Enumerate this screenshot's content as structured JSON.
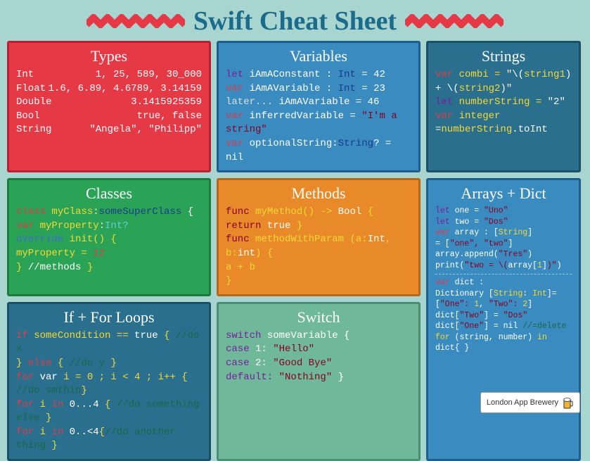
{
  "title": "Swift Cheat Sheet",
  "footer": {
    "label": "London App Brewery"
  },
  "types": {
    "title": "Types",
    "rows": [
      {
        "name": "Int",
        "example": "1, 25, 589, 30_000"
      },
      {
        "name": "Float",
        "example": "1.6, 6.89, 4.6789, 3.14159"
      },
      {
        "name": "Double",
        "example": "3.1415925359"
      },
      {
        "name": "Bool",
        "example": "true, false"
      },
      {
        "name": "String",
        "example": "\"Angela\",  \"Philipp\""
      }
    ]
  },
  "variables": {
    "title": "Variables",
    "lines": [
      {
        "parts": [
          {
            "t": "let ",
            "c": "purple"
          },
          {
            "t": "iAmAConstant : ",
            "c": "white"
          },
          {
            "t": "Int",
            "c": "dblue"
          },
          {
            "t": " = 42",
            "c": "white"
          }
        ]
      },
      {
        "parts": [
          {
            "t": "var ",
            "c": "red"
          },
          {
            "t": "iAmAVariable : ",
            "c": "white"
          },
          {
            "t": "Int",
            "c": "dblue"
          },
          {
            "t": " = 23",
            "c": "white"
          }
        ]
      },
      {
        "parts": [
          {
            "t": "later...  ",
            "c": "gray"
          },
          {
            "t": "iAmAVariable = 46",
            "c": "white"
          }
        ]
      },
      {
        "parts": [
          {
            "t": "var ",
            "c": "red"
          },
          {
            "t": "inferredVariable = ",
            "c": "white"
          },
          {
            "t": "\"I'm a string\"",
            "c": "darkred"
          }
        ]
      },
      {
        "parts": [
          {
            "t": "var ",
            "c": "red"
          },
          {
            "t": "optionalString:",
            "c": "white"
          },
          {
            "t": "String",
            "c": "dblue"
          },
          {
            "t": "? = nil",
            "c": "white"
          }
        ]
      }
    ]
  },
  "strings": {
    "title": "Strings",
    "lines": [
      {
        "parts": [
          {
            "t": "var ",
            "c": "red"
          },
          {
            "t": "combi = ",
            "c": "yellow"
          },
          {
            "t": "\"\\(",
            "c": "white"
          },
          {
            "t": "string1",
            "c": "yellow"
          },
          {
            "t": ")",
            "c": "white"
          }
        ]
      },
      {
        "parts": [
          {
            "t": "+ \\(",
            "c": "white"
          },
          {
            "t": "string2",
            "c": "yellow"
          },
          {
            "t": ")\"",
            "c": "white"
          }
        ]
      },
      {
        "parts": [
          {
            "t": "let ",
            "c": "purple"
          },
          {
            "t": "numberString = ",
            "c": "yellow"
          },
          {
            "t": "\"2\"",
            "c": "white"
          }
        ]
      },
      {
        "parts": [
          {
            "t": "var ",
            "c": "red"
          },
          {
            "t": "integer",
            "c": "yellow"
          }
        ]
      },
      {
        "parts": [
          {
            "t": "=",
            "c": "white"
          },
          {
            "t": "numberString",
            "c": "yellow"
          },
          {
            "t": ".toInt",
            "c": "white"
          }
        ]
      }
    ]
  },
  "classes": {
    "title": "Classes",
    "lines": [
      {
        "parts": [
          {
            "t": "class ",
            "c": "red"
          },
          {
            "t": "myClass",
            "c": "yellow"
          },
          {
            "t": ":",
            "c": "white"
          },
          {
            "t": "someSuperClass",
            "c": "dblue"
          },
          {
            "t": " {",
            "c": "white"
          }
        ]
      },
      {
        "parts": [
          {
            "t": "  var ",
            "c": "red"
          },
          {
            "t": "myProperty",
            "c": "yellow"
          },
          {
            "t": ":",
            "c": "white"
          },
          {
            "t": "Int?",
            "c": "cyan"
          }
        ]
      },
      {
        "parts": [
          {
            "t": "  override ",
            "c": "blue"
          },
          {
            "t": "init() {",
            "c": "yellow"
          }
        ]
      },
      {
        "parts": [
          {
            "t": "    myProperty = ",
            "c": "yellow"
          },
          {
            "t": "12",
            "c": "red"
          }
        ]
      },
      {
        "parts": [
          {
            "t": "  } ",
            "c": "yellow"
          },
          {
            "t": "//methods ",
            "c": "white"
          },
          {
            "t": "}",
            "c": "yellow"
          }
        ]
      }
    ]
  },
  "methods": {
    "title": "Methods",
    "lines": [
      {
        "parts": [
          {
            "t": "func ",
            "c": "darkred"
          },
          {
            "t": "myMethod() -> ",
            "c": "yellow"
          },
          {
            "t": "Bool",
            "c": "white"
          },
          {
            "t": " {",
            "c": "yellow"
          }
        ]
      },
      {
        "parts": [
          {
            "t": "  return ",
            "c": "darkred"
          },
          {
            "t": "true ",
            "c": "white"
          },
          {
            "t": "}",
            "c": "yellow"
          }
        ]
      },
      {
        "parts": [
          {
            "t": "func ",
            "c": "darkred"
          },
          {
            "t": "methodWithParam (a:",
            "c": "yellow"
          },
          {
            "t": "Int",
            "c": "white"
          },
          {
            "t": ", b:",
            "c": "yellow"
          },
          {
            "t": "int",
            "c": "white"
          },
          {
            "t": ") {",
            "c": "yellow"
          }
        ]
      },
      {
        "parts": [
          {
            "t": "   a + b",
            "c": "yellow"
          }
        ]
      },
      {
        "parts": [
          {
            "t": "   }",
            "c": "yellow"
          }
        ]
      }
    ]
  },
  "arrays": {
    "title": "Arrays + Dict",
    "lines": [
      {
        "parts": [
          {
            "t": "let ",
            "c": "purple"
          },
          {
            "t": "one = ",
            "c": "white"
          },
          {
            "t": "\"Uno\"",
            "c": "darkred"
          }
        ]
      },
      {
        "parts": [
          {
            "t": "let ",
            "c": "purple"
          },
          {
            "t": "two = ",
            "c": "white"
          },
          {
            "t": "\"Dos\"",
            "c": "darkred"
          }
        ]
      },
      {
        "parts": [
          {
            "t": "var ",
            "c": "red"
          },
          {
            "t": "array  :  [",
            "c": "white"
          },
          {
            "t": "String",
            "c": "yellow"
          },
          {
            "t": "]",
            "c": "white"
          }
        ]
      },
      {
        "parts": [
          {
            "t": "= [",
            "c": "white"
          },
          {
            "t": "\"one\", \"two\"",
            "c": "darkred"
          },
          {
            "t": "]",
            "c": "white"
          }
        ]
      },
      {
        "parts": [
          {
            "t": "  array.append(",
            "c": "white"
          },
          {
            "t": "\"Tres\"",
            "c": "darkred"
          },
          {
            "t": ")",
            "c": "white"
          }
        ]
      },
      {
        "parts": [
          {
            "t": "print(",
            "c": "white"
          },
          {
            "t": "\"two = \\(",
            "c": "darkred"
          },
          {
            "t": "array[",
            "c": "white"
          },
          {
            "t": "1",
            "c": "yellow"
          },
          {
            "t": "]",
            "c": "white"
          },
          {
            "t": ")\"",
            "c": "darkred"
          },
          {
            "t": ")",
            "c": "white"
          }
        ]
      }
    ],
    "lines2": [
      {
        "parts": [
          {
            "t": "var ",
            "c": "red"
          },
          {
            "t": "dict :",
            "c": "white"
          }
        ]
      },
      {
        "parts": [
          {
            "t": "Dictionary [",
            "c": "white"
          },
          {
            "t": "String",
            "c": "yellow"
          },
          {
            "t": ": ",
            "c": "white"
          },
          {
            "t": "Int",
            "c": "yellow"
          },
          {
            "t": "]=",
            "c": "white"
          }
        ]
      },
      {
        "parts": [
          {
            "t": "[",
            "c": "white"
          },
          {
            "t": "\"One\": ",
            "c": "darkred"
          },
          {
            "t": "1",
            "c": "yellow"
          },
          {
            "t": ", ",
            "c": "white"
          },
          {
            "t": "\"Two\": ",
            "c": "darkred"
          },
          {
            "t": "2",
            "c": "yellow"
          },
          {
            "t": "]",
            "c": "white"
          }
        ]
      },
      {
        "parts": [
          {
            "t": "  dict[",
            "c": "white"
          },
          {
            "t": "\"Two\"",
            "c": "darkred"
          },
          {
            "t": "] = ",
            "c": "white"
          },
          {
            "t": "\"Dos\"",
            "c": "darkred"
          }
        ]
      },
      {
        "parts": [
          {
            "t": "  dict[",
            "c": "white"
          },
          {
            "t": "\"One\"",
            "c": "darkred"
          },
          {
            "t": "] = nil ",
            "c": "white"
          },
          {
            "t": "//=delete",
            "c": "dgreen"
          }
        ]
      },
      {
        "parts": [
          {
            "t": "for ",
            "c": "yellow"
          },
          {
            "t": "(string, number) ",
            "c": "white"
          },
          {
            "t": "in ",
            "c": "yellow"
          },
          {
            "t": "dict{ }",
            "c": "white"
          }
        ]
      }
    ]
  },
  "loops": {
    "title": "If + For Loops",
    "lines": [
      {
        "parts": [
          {
            "t": "if ",
            "c": "red"
          },
          {
            "t": "someCondition == ",
            "c": "yellow"
          },
          {
            "t": "true ",
            "c": "white"
          },
          {
            "t": "{ ",
            "c": "yellow"
          },
          {
            "t": "//do x",
            "c": "dgreen"
          }
        ]
      },
      {
        "parts": [
          {
            "t": "   } ",
            "c": "yellow"
          },
          {
            "t": "else ",
            "c": "red"
          },
          {
            "t": "{ ",
            "c": "yellow"
          },
          {
            "t": "//do y ",
            "c": "dgreen"
          },
          {
            "t": "}",
            "c": "yellow"
          }
        ]
      },
      {
        "parts": [
          {
            "t": "for ",
            "c": "red"
          },
          {
            "t": "var ",
            "c": "white"
          },
          {
            "t": "i = 0 ; i < 4 ; i++ { ",
            "c": "yellow"
          },
          {
            "t": "//do smthin",
            "c": "dgreen"
          },
          {
            "t": "}",
            "c": "yellow"
          }
        ]
      },
      {
        "parts": [
          {
            "t": "for ",
            "c": "red"
          },
          {
            "t": "i ",
            "c": "yellow"
          },
          {
            "t": "in ",
            "c": "red"
          },
          {
            "t": "0...4",
            "c": "white"
          },
          {
            "t": " { ",
            "c": "yellow"
          },
          {
            "t": "//do something else ",
            "c": "dgreen"
          },
          {
            "t": "}",
            "c": "yellow"
          }
        ]
      },
      {
        "parts": [
          {
            "t": "for ",
            "c": "red"
          },
          {
            "t": "i ",
            "c": "yellow"
          },
          {
            "t": "in ",
            "c": "red"
          },
          {
            "t": "0..<4",
            "c": "white"
          },
          {
            "t": "{",
            "c": "yellow"
          },
          {
            "t": "//do another thing ",
            "c": "dgreen"
          },
          {
            "t": "}",
            "c": "yellow"
          }
        ]
      }
    ]
  },
  "switch": {
    "title": "Switch",
    "lines": [
      {
        "parts": [
          {
            "t": "switch ",
            "c": "purple"
          },
          {
            "t": "someVariable {",
            "c": "white"
          }
        ]
      },
      {
        "parts": [
          {
            "t": "  case ",
            "c": "purple"
          },
          {
            "t": "1: ",
            "c": "white"
          },
          {
            "t": "\"Hello\"",
            "c": "darkred"
          }
        ]
      },
      {
        "parts": [
          {
            "t": "  case ",
            "c": "purple"
          },
          {
            "t": "2: ",
            "c": "white"
          },
          {
            "t": "\"Good Bye\"",
            "c": "darkred"
          }
        ]
      },
      {
        "parts": [
          {
            "t": "  default: ",
            "c": "purple"
          },
          {
            "t": "\"Nothing\" ",
            "c": "darkred"
          },
          {
            "t": "}",
            "c": "white"
          }
        ]
      }
    ]
  }
}
